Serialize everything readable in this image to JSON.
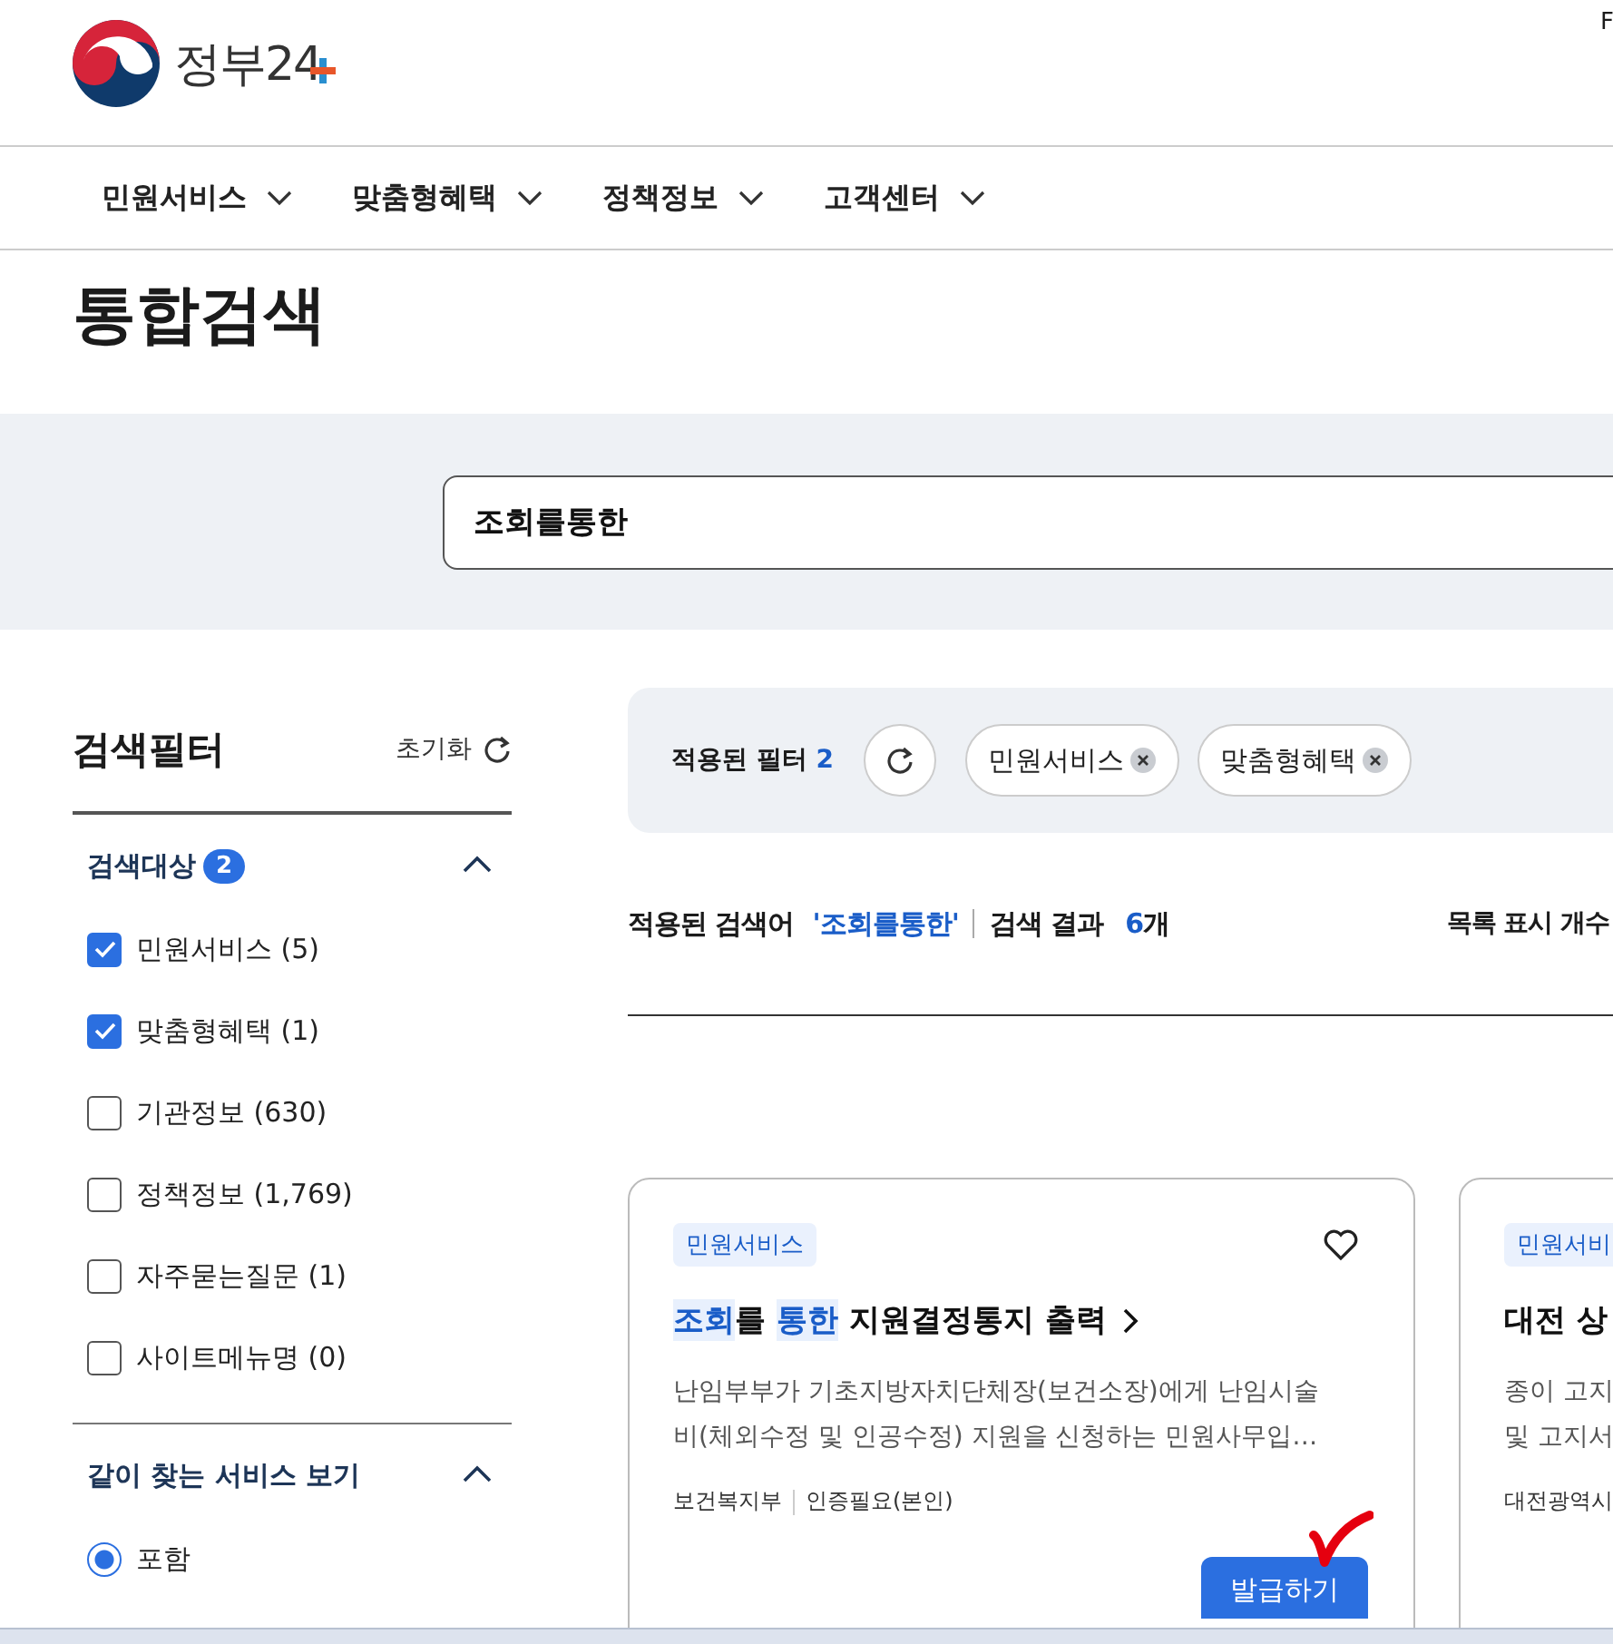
{
  "header": {
    "logo_text": "정부24",
    "corner_text": "F"
  },
  "nav": [
    {
      "label": "민원서비스"
    },
    {
      "label": "맞춤형혜택"
    },
    {
      "label": "정책정보"
    },
    {
      "label": "고객센터"
    }
  ],
  "page_title": "통합검색",
  "search": {
    "value": "조회를통한"
  },
  "sidebar": {
    "title": "검색필터",
    "reset": "초기화",
    "sections": [
      {
        "kind": "checkbox",
        "title": "검색대상",
        "badge": "2",
        "expanded": true,
        "items": [
          {
            "label": "민원서비스 (5)",
            "checked": true
          },
          {
            "label": "맞춤형혜택 (1)",
            "checked": true
          },
          {
            "label": "기관정보 (630)",
            "checked": false
          },
          {
            "label": "정책정보 (1,769)",
            "checked": false
          },
          {
            "label": "자주묻는질문 (1)",
            "checked": false
          },
          {
            "label": "사이트메뉴명 (0)",
            "checked": false
          }
        ]
      },
      {
        "kind": "radio",
        "title": "같이 찾는 서비스 보기",
        "expanded": true,
        "items": [
          {
            "label": "포함",
            "selected": true
          }
        ]
      }
    ]
  },
  "filters": {
    "label": "적용된 필터",
    "count": "2",
    "chips": [
      {
        "label": "민원서비스"
      },
      {
        "label": "맞춤형혜택"
      }
    ]
  },
  "summary": {
    "term_label": "적용된 검색어",
    "term": "'조회를통한'",
    "result_label": "검색 결과",
    "count": "6",
    "count_unit": "개",
    "page_size_label": "목록 표시 개수"
  },
  "cards": [
    {
      "tag": "민원서비스",
      "title_parts": [
        {
          "text": "조회",
          "highlighted": true
        },
        {
          "text": "를 ",
          "highlighted": false
        },
        {
          "text": "통한",
          "highlighted": true
        },
        {
          "text": " 지원결정통지 출력",
          "highlighted": false
        }
      ],
      "description": [
        "난임부부가 기초지방자치단체장(보건소장)에게 난임시술",
        "비(체외수정 및 인공수정) 지원을 신청하는 민원사무입…"
      ],
      "meta": [
        "보건복지부",
        "인증필요(본인)"
      ],
      "button": "발급하기"
    },
    {
      "tag": "민원서비",
      "title_parts": [
        {
          "text": "대전 상",
          "highlighted": false
        }
      ],
      "description": [
        "종이 고지",
        "및 고지서"
      ],
      "meta": [
        "대전광역시"
      ]
    }
  ]
}
